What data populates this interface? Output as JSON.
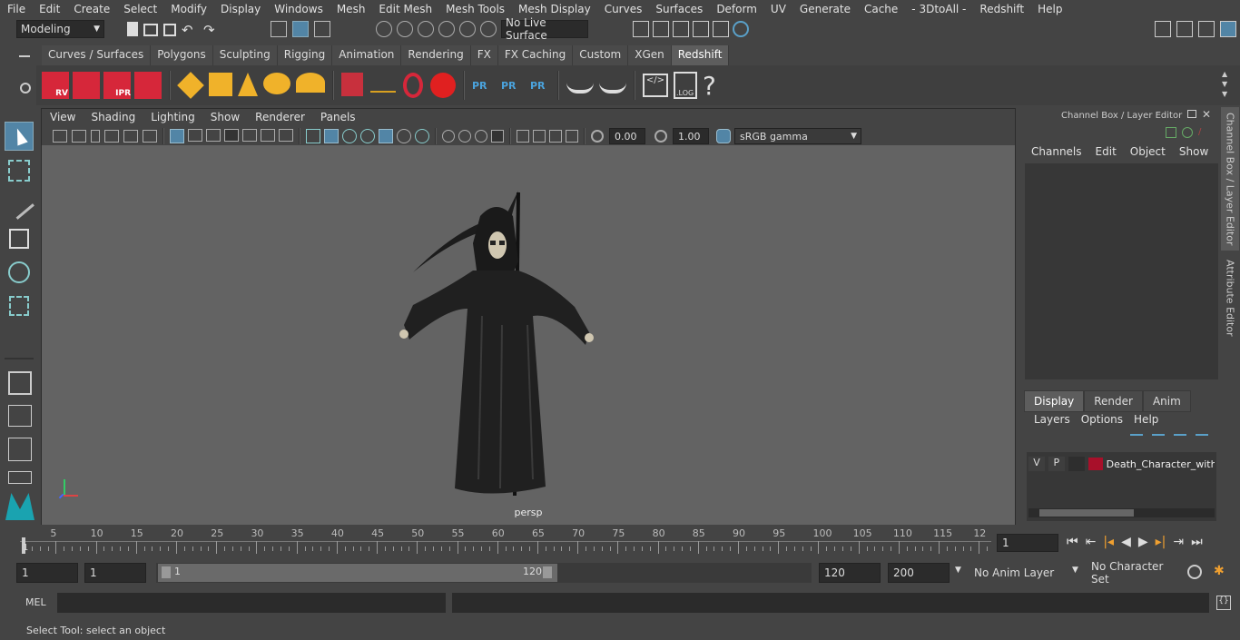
{
  "menubar": [
    "File",
    "Edit",
    "Create",
    "Select",
    "Modify",
    "Display",
    "Windows",
    "Mesh",
    "Edit Mesh",
    "Mesh Tools",
    "Mesh Display",
    "Curves",
    "Surfaces",
    "Deform",
    "UV",
    "Generate",
    "Cache",
    "- 3DtoAll -",
    "Redshift",
    "Help"
  ],
  "status": {
    "mode": "Modeling",
    "live_surface": "No Live Surface"
  },
  "shelf_tabs": [
    "Curves / Surfaces",
    "Polygons",
    "Sculpting",
    "Rigging",
    "Animation",
    "Rendering",
    "FX",
    "FX Caching",
    "Custom",
    "XGen",
    "Redshift"
  ],
  "shelf_active": "Redshift",
  "shelf_icon_labels": {
    "rv": "RV",
    "ipr": "IPR",
    "pr": "PR",
    "log": ".LOG",
    "help": "?"
  },
  "viewport": {
    "menus": [
      "View",
      "Shading",
      "Lighting",
      "Show",
      "Renderer",
      "Panels"
    ],
    "exposure": "0.00",
    "gamma": "1.00",
    "color_space": "sRGB gamma",
    "camera": "persp"
  },
  "channel_box": {
    "title": "Channel Box / Layer Editor",
    "menus": [
      "Channels",
      "Edit",
      "Object",
      "Show"
    ]
  },
  "side_tabs": {
    "channel_box": "Channel Box / Layer Editor",
    "attribute_editor": "Attribute Editor"
  },
  "layer_editor": {
    "tabs": [
      "Display",
      "Render",
      "Anim"
    ],
    "active": "Display",
    "menus": [
      "Layers",
      "Options",
      "Help"
    ],
    "layer": {
      "v": "V",
      "p": "P",
      "name": "Death_Character_with_",
      "color": "#a8102a"
    }
  },
  "timeline": {
    "ticks": [
      "5",
      "10",
      "15",
      "20",
      "25",
      "30",
      "35",
      "40",
      "45",
      "50",
      "55",
      "60",
      "65",
      "70",
      "75",
      "80",
      "85",
      "90",
      "95",
      "100",
      "105",
      "110",
      "115",
      "12"
    ],
    "start_label": "1",
    "current_frame": "1"
  },
  "range": {
    "start": "1",
    "playback_start": "1",
    "slider_start": "1",
    "slider_end": "120",
    "end": "120",
    "anim_end": "200",
    "anim_layer": "No Anim Layer",
    "char_set": "No Character Set"
  },
  "mel": {
    "label": "MEL"
  },
  "help_line": "Select Tool: select an object",
  "colors": {
    "accent": "#5285a6",
    "panel": "#444444",
    "viewport_bg": "#636363",
    "redshift_red": "#d6273a",
    "gold": "#f0b22a"
  }
}
